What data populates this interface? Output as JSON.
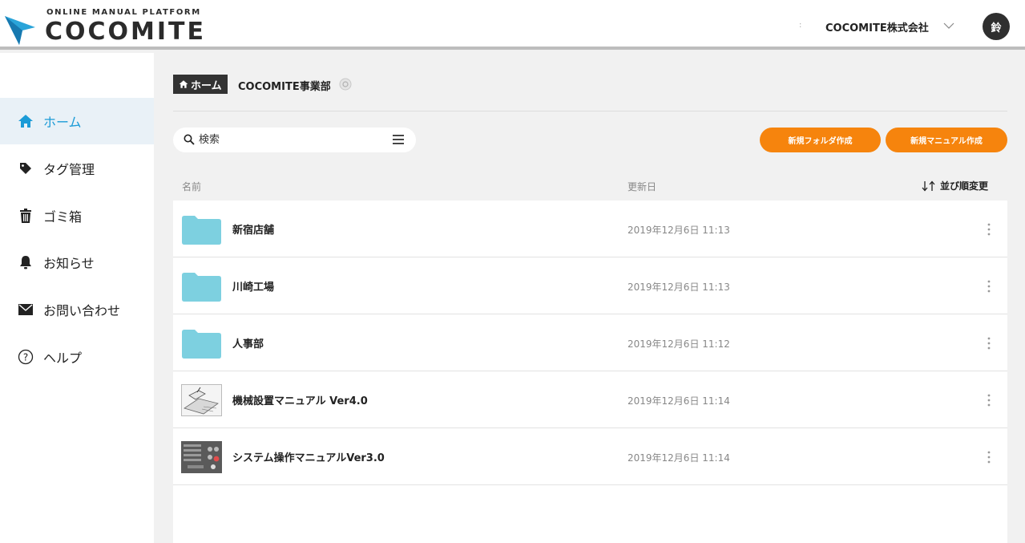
{
  "header": {
    "logo_sub": "ONLINE MANUAL PLATFORM",
    "logo_main": "COCOMITE",
    "separator": ":",
    "company": "COCOMITE株式会社",
    "avatar_initial": "鈴"
  },
  "sidebar": {
    "items": [
      {
        "label": "ホーム",
        "icon": "home-icon",
        "active": true
      },
      {
        "label": "タグ管理",
        "icon": "tag-icon"
      },
      {
        "label": "ゴミ箱",
        "icon": "trash-icon"
      },
      {
        "label": "お知らせ",
        "icon": "bell-icon"
      },
      {
        "label": "お問い合わせ",
        "icon": "mail-icon"
      },
      {
        "label": "ヘルプ",
        "icon": "help-icon"
      }
    ]
  },
  "breadcrumb": {
    "home": "ホーム",
    "current": "COCOMITE事業部"
  },
  "search": {
    "placeholder": "検索"
  },
  "buttons": {
    "new_folder": "新規フォルダ作成",
    "new_manual": "新規マニュアル作成"
  },
  "table": {
    "col_name": "名前",
    "col_date": "更新日",
    "sort_label": "並び順変更",
    "rows": [
      {
        "type": "folder",
        "name": "新宿店舗",
        "date": "2019年12月6日 11:13"
      },
      {
        "type": "folder",
        "name": "川崎工場",
        "date": "2019年12月6日 11:13"
      },
      {
        "type": "folder",
        "name": "人事部",
        "date": "2019年12月6日 11:12"
      },
      {
        "type": "manual",
        "name": "機械設置マニュアル Ver4.0",
        "date": "2019年12月6日 11:14"
      },
      {
        "type": "manual",
        "name": "システム操作マニュアルVer3.0",
        "date": "2019年12月6日 11:14"
      }
    ]
  },
  "colors": {
    "accent": "#1b9bd7",
    "orange": "#f6840d",
    "folder": "#7dd0e0"
  }
}
